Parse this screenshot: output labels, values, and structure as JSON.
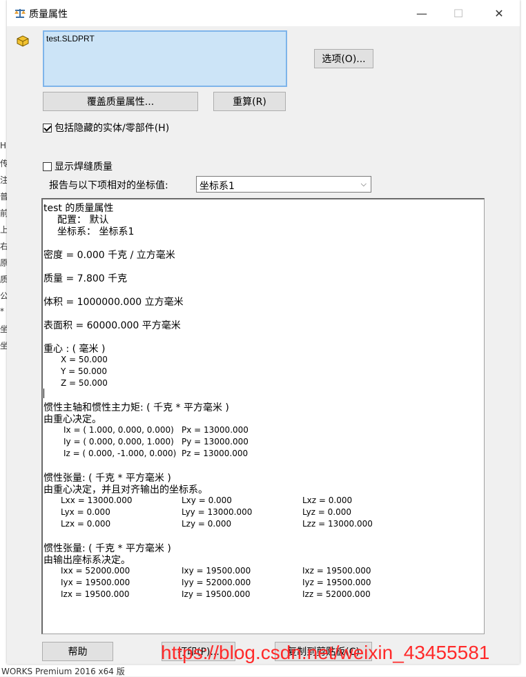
{
  "window": {
    "title": "质量属性",
    "minimize_glyph": "—",
    "maximize_glyph": "☐",
    "close_glyph": "✕"
  },
  "selection": {
    "items": [
      "test.SLDPRT"
    ]
  },
  "buttons": {
    "options": "选项(O)...",
    "override": "覆盖质量属性...",
    "recalc": "重算(R)",
    "help": "帮助",
    "print": "打印(P)...",
    "copy": "复制到剪贴板(C)"
  },
  "options": {
    "include_hidden": {
      "label": "包括隐藏的实体/零部件(H)",
      "checked": true
    },
    "show_weld": {
      "label": "显示焊缝质量",
      "checked": false
    }
  },
  "report": {
    "label": "报告与以下项相对的坐标值:",
    "selected": "坐标系1"
  },
  "results": {
    "header": "test 的质量属性",
    "config": "配置： 默认",
    "coord": "坐标系： 坐标系1",
    "density": "密度 = 0.000 千克 / 立方毫米",
    "mass": "质量 = 7.800 千克",
    "volume": "体积 = 1000000.000 立方毫米",
    "area": "表面积 = 60000.000  平方毫米",
    "cog_title": "重心 : ( 毫米 )",
    "cog": [
      "X = 50.000",
      "Y = 50.000",
      "Z = 50.000"
    ],
    "principal_title": "惯性主轴和惯性主力矩: ( 千克 *  平方毫米 )",
    "principal_sub": "由重心决定。",
    "principal_axes": [
      {
        "axis": "Ix = ( 1.000,  0.000,  0.000)",
        "moment": "Px = 13000.000"
      },
      {
        "axis": "Iy = ( 0.000,  0.000,  1.000)",
        "moment": "Py = 13000.000"
      },
      {
        "axis": "Iz = ( 0.000, -1.000,  0.000)",
        "moment": "Pz = 13000.000"
      }
    ],
    "tensor1_title": "惯性张量: ( 千克 *  平方毫米 )",
    "tensor1_sub": "由重心决定，并且对齐输出的坐标系。",
    "tensor1": [
      [
        "Lxx = 13000.000",
        "Lxy = 0.000",
        "Lxz = 0.000"
      ],
      [
        "Lyx = 0.000",
        "Lyy = 13000.000",
        "Lyz = 0.000"
      ],
      [
        "Lzx = 0.000",
        "Lzy = 0.000",
        "Lzz = 13000.000"
      ]
    ],
    "tensor2_title": "惯性张量: ( 千克 *  平方毫米 )",
    "tensor2_sub": "由输出座标系决定。",
    "tensor2": [
      [
        "Ixx = 52000.000",
        "Ixy = 19500.000",
        "Ixz = 19500.000"
      ],
      [
        "Iyx = 19500.000",
        "Iyy = 52000.000",
        "Iyz = 19500.000"
      ],
      [
        "Izx = 19500.000",
        "Izy = 19500.000",
        "Izz = 52000.000"
      ]
    ]
  },
  "background": {
    "bottom_text": "WORKS Premium 2016 x64 版",
    "left_glyphs": [
      "H",
      "传",
      "注",
      "普",
      "前",
      "上",
      "右",
      "原",
      "质",
      "公",
      "*",
      "坐",
      "坐"
    ]
  },
  "watermark": "https://blog.csdn.net/weixin_43455581"
}
